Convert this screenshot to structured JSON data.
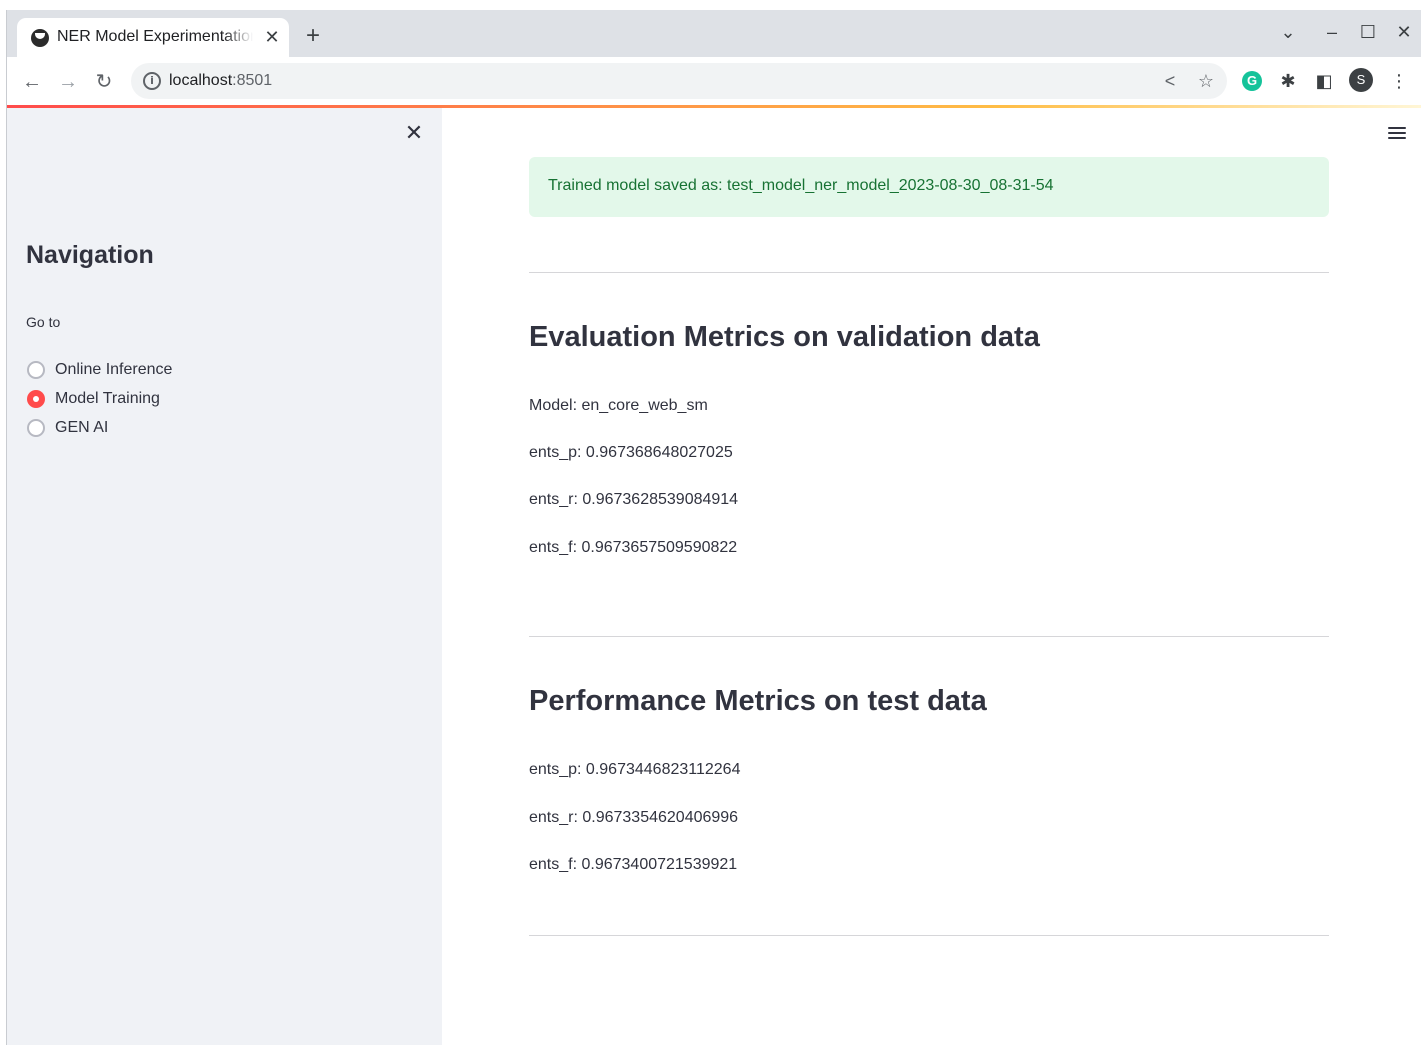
{
  "browser": {
    "tab_title": "NER Model Experimentation",
    "url_host": "localhost",
    "url_port": ":8501",
    "profile_initial": "S",
    "extension_initial": "G"
  },
  "sidebar": {
    "title": "Navigation",
    "radio_label": "Go to",
    "options": [
      {
        "label": "Online Inference",
        "selected": false
      },
      {
        "label": "Model Training",
        "selected": true
      },
      {
        "label": "GEN AI",
        "selected": false
      }
    ]
  },
  "main": {
    "alert_text": "Trained model saved as: test_model_ner_model_2023-08-30_08-31-54",
    "evaluation": {
      "heading": "Evaluation Metrics on validation data",
      "lines": [
        "Model: en_core_web_sm",
        "ents_p: 0.967368648027025",
        "ents_r: 0.9673628539084914",
        "ents_f: 0.9673657509590822"
      ]
    },
    "performance": {
      "heading": "Performance Metrics on test data",
      "lines": [
        "ents_p: 0.9673446823112264",
        "ents_r: 0.9673354620406996",
        "ents_f: 0.9673400721539921"
      ]
    }
  },
  "colors": {
    "accent": "#ff4b4b",
    "success_bg": "#e3f8ea",
    "success_text": "#177233",
    "sidebar_bg": "#f0f2f6"
  }
}
